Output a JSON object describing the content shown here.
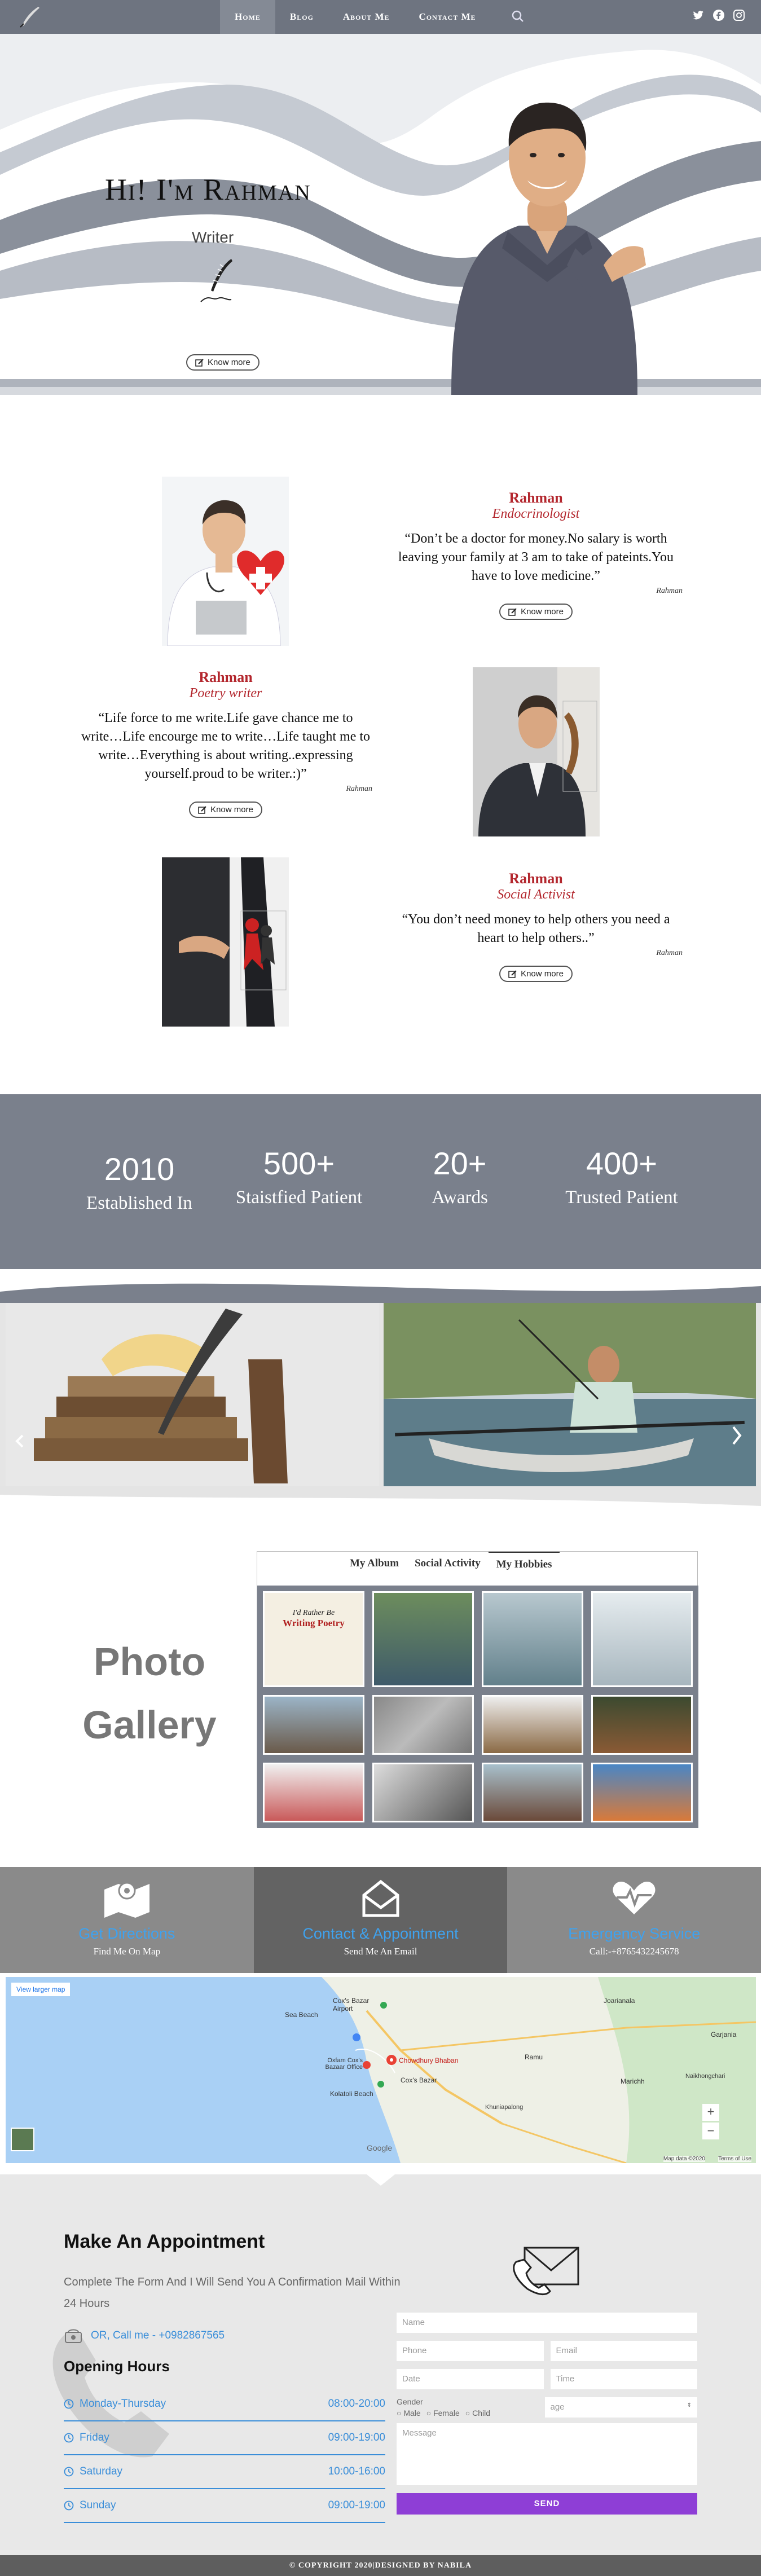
{
  "nav": {
    "items": [
      "Home",
      "Blog",
      "About Me",
      "Contact Me"
    ],
    "active": "Home",
    "social": [
      "twitter-icon",
      "facebook-icon",
      "instagram-icon"
    ]
  },
  "hero": {
    "greeting": "Hi! I'm Rahman",
    "role": "Writer",
    "button": "Know more"
  },
  "profiles": [
    {
      "name": "Rahman",
      "title": "Endocrinologist",
      "quote": "“Don’t be a doctor for money.No salary is worth leaving your family at 3 am to take of pateints.You have to love medicine.”",
      "signature": "Rahman",
      "button": "Know more"
    },
    {
      "name": "Rahman",
      "title": "Poetry writer",
      "quote": "“Life force to me write.Life gave chance  me to write…Life encourge  me to write…Life taught me to write…Everything is about writing..expressing yourself.proud to be writer.:)”",
      "signature": "Rahman",
      "button": "Know more"
    },
    {
      "name": "Rahman",
      "title": "Social Activist",
      "quote": "“You don’t need money to help others you need a heart to help others..”",
      "signature": "Rahman",
      "button": "Know more"
    }
  ],
  "stats": [
    {
      "number": "2010",
      "label": "Established In"
    },
    {
      "number": "500+",
      "label": "Staistfied Patient"
    },
    {
      "number": "20+",
      "label": "Awards"
    },
    {
      "number": "400+",
      "label": "Trusted Patient"
    }
  ],
  "gallery": {
    "title_line1": "Photo",
    "title_line2": "Gallery",
    "tabs": [
      "My Album",
      "Social Activity",
      "My Hobbies"
    ],
    "active_tab": "My Hobbies",
    "poetry_caption_1": "I'd Rather Be",
    "poetry_caption_2": "Writing Poetry"
  },
  "info": [
    {
      "heading": "Get Directions",
      "sub": "Find Me On Map"
    },
    {
      "heading": "Contact & Appointment",
      "sub": "Send Me An Email"
    },
    {
      "heading": "Emergency Service",
      "sub": "Call:-+8765432245678"
    }
  ],
  "map": {
    "larger_link": "View larger map",
    "labels": [
      "Cox's Bazar Airport",
      "Sea Beach",
      "Chowdhury Bhaban",
      "Oxfam Cox's Bazaar Office",
      "Cox's Bazar",
      "Kolatoli Beach",
      "Ramu",
      "Joarianala",
      "Garjania",
      "Marichh",
      "Naikhongchari",
      "Khuniapalong",
      "Google"
    ],
    "attribution": "Map data ©2020",
    "terms": "Terms of Use"
  },
  "appointment": {
    "heading": "Make An Appointment",
    "description": "Complete The Form And I Will Send You A Confirmation Mail Within 24 Hours",
    "call": "OR, Call me - +0982867565",
    "hours_heading": "Opening Hours",
    "hours": [
      {
        "day": "Monday-Thursday",
        "time": "08:00-20:00"
      },
      {
        "day": "Friday",
        "time": "09:00-19:00"
      },
      {
        "day": "Saturday",
        "time": "10:00-16:00"
      },
      {
        "day": "Sunday",
        "time": "09:00-19:00"
      }
    ],
    "form": {
      "name": "Name",
      "phone": "Phone",
      "email": "Email",
      "date": "Date",
      "time": "Time",
      "gender_label": "Gender",
      "gender_options": [
        "Male",
        "Female",
        "Child"
      ],
      "age": "age",
      "message": "Message",
      "send": "SEND"
    }
  },
  "footer": "© COPYRIGHT 2020|DESIGNED BY NABILA"
}
